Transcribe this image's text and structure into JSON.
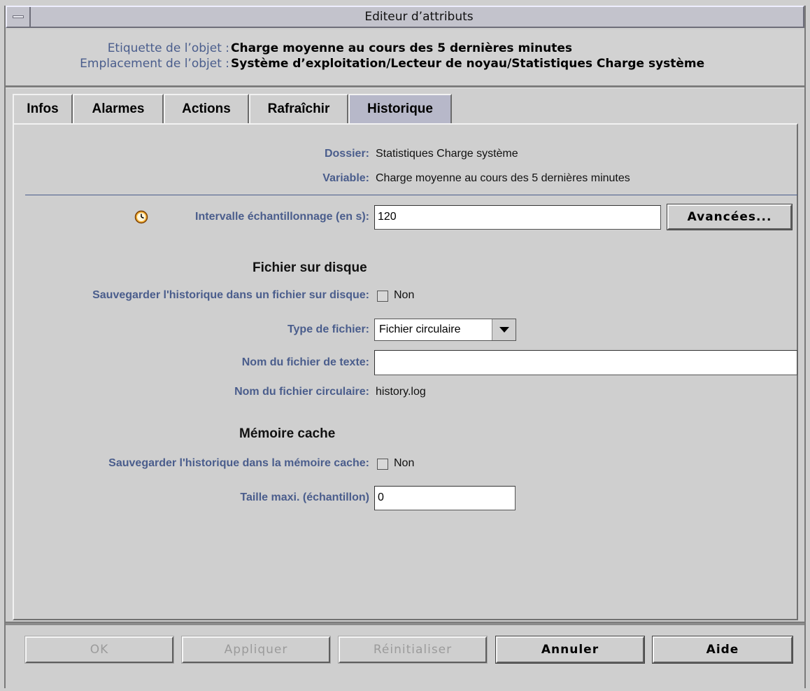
{
  "window": {
    "title": "Editeur d’attributs"
  },
  "header": {
    "object_label_label": "Etiquette de l’objet :",
    "object_label_value": "Charge moyenne au cours des 5 dernières minutes",
    "object_location_label": "Emplacement de l’objet :",
    "object_location_value": "Système d’exploitation/Lecteur de noyau/Statistiques Charge système"
  },
  "tabs": [
    {
      "label": "Infos",
      "active": false
    },
    {
      "label": "Alarmes",
      "active": false
    },
    {
      "label": "Actions",
      "active": false
    },
    {
      "label": "Rafraîchir",
      "active": false
    },
    {
      "label": "Historique",
      "active": true
    }
  ],
  "panel": {
    "folder_label": "Dossier:",
    "folder_value": "Statistiques Charge système",
    "variable_label": "Variable:",
    "variable_value": "Charge moyenne au cours des 5 dernières minutes",
    "interval_label": "Intervalle échantillonnage (en s):",
    "interval_icon": "clock-icon",
    "interval_value": "120",
    "advanced_button": "Avancées...",
    "disk_section": {
      "title": "Fichier sur disque",
      "save_disk_label": "Sauvegarder l'historique dans un fichier sur disque:",
      "save_disk_checked": false,
      "save_disk_text": "Non",
      "file_type_label": "Type de fichier:",
      "file_type_value": "Fichier circulaire",
      "text_file_label": "Nom du fichier de texte:",
      "text_file_value": "",
      "circular_file_label": "Nom du fichier circulaire:",
      "circular_file_value": "history.log"
    },
    "cache_section": {
      "title": "Mémoire cache",
      "save_cache_label": "Sauvegarder l'historique dans la mémoire cache:",
      "save_cache_checked": false,
      "save_cache_text": "Non",
      "max_size_label": "Taille maxi. (échantillon)",
      "max_size_value": "0"
    }
  },
  "footer": {
    "ok": "OK",
    "apply": "Appliquer",
    "reset": "Réinitialiser",
    "cancel": "Annuler",
    "help": "Aide"
  },
  "colors": {
    "label_blue": "#4a5d8c",
    "active_tab": "#b7b8c9",
    "background": "#cfcfcf"
  }
}
